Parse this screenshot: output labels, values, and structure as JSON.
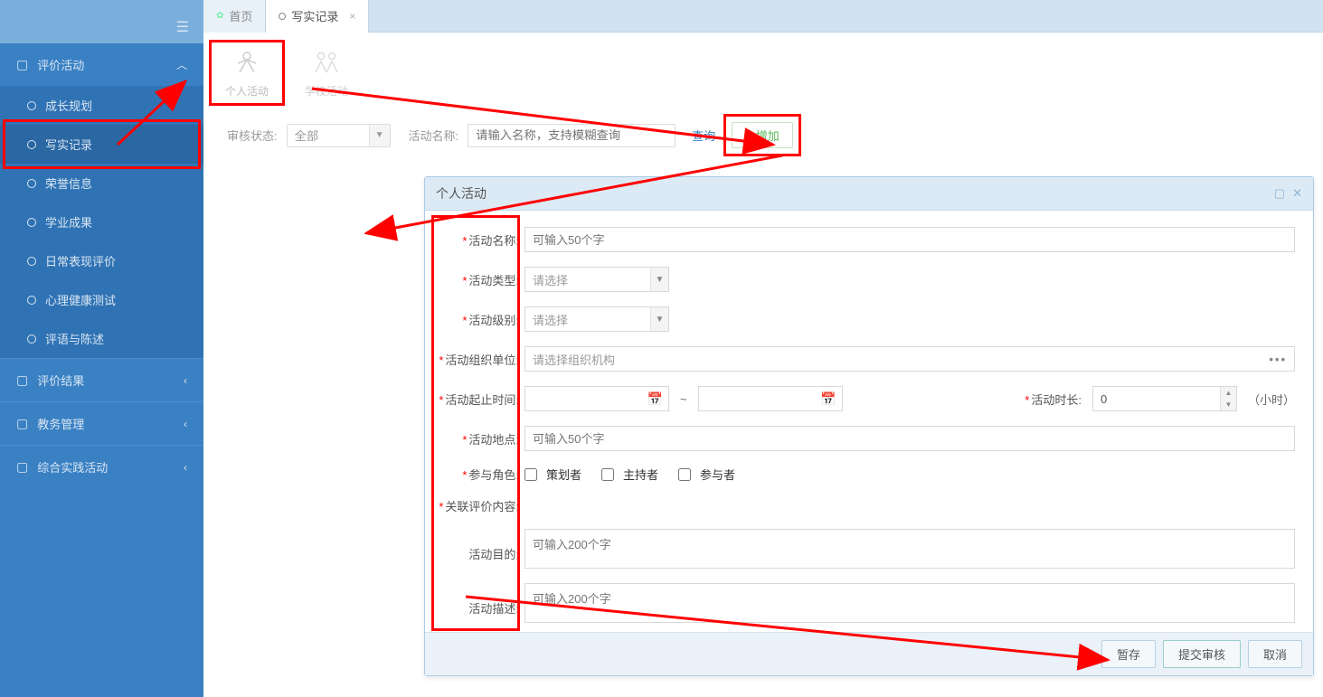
{
  "tabs": {
    "home": "首页",
    "record": "写实记录"
  },
  "sidebar": {
    "group_eval": "评价活动",
    "items": {
      "growth": "成长规划",
      "record": "写实记录",
      "honor": "荣誉信息",
      "academic": "学业成果",
      "daily": "日常表现评价",
      "mental": "心理健康测试",
      "comment": "评语与陈述"
    },
    "group_result": "评价结果",
    "group_edu": "教务管理",
    "group_practice": "综合实践活动"
  },
  "subtabs": {
    "personal": "个人活动",
    "school": "学校活动"
  },
  "filter": {
    "status_label": "审核状态:",
    "status_value": "全部",
    "name_label": "活动名称:",
    "name_placeholder": "请输入名称，支持模糊查询",
    "search": "查询",
    "add": "增加"
  },
  "dialog": {
    "title": "个人活动",
    "labels": {
      "name": "活动名称:",
      "type": "活动类型:",
      "level": "活动级别:",
      "org": "活动组织单位:",
      "time": "活动起止时间:",
      "duration": "活动时长:",
      "location": "活动地点:",
      "role": "参与角色:",
      "related": "关联评价内容:",
      "purpose": "活动目的:",
      "desc": "活动描述:"
    },
    "placeholders": {
      "fifty": "可输入50个字",
      "select": "请选择",
      "org": "请选择组织机构",
      "twohundred": "可输入200个字"
    },
    "duration_value": "0",
    "duration_unit": "（小时）",
    "time_sep": "~",
    "roles": {
      "planner": "策划者",
      "host": "主持者",
      "participant": "参与者"
    },
    "buttons": {
      "draft": "暂存",
      "submit": "提交审核",
      "cancel": "取消"
    }
  }
}
